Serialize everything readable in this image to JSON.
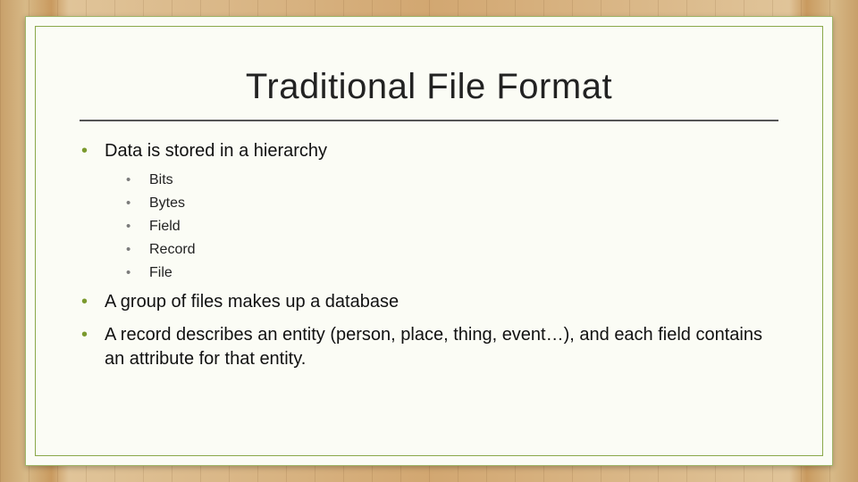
{
  "title": "Traditional File Format",
  "bullets": {
    "b1": "Data is stored in a hierarchy",
    "sub": {
      "s1": "Bits",
      "s2": "Bytes",
      "s3": "Field",
      "s4": "Record",
      "s5": "File"
    },
    "b2": "A group of files makes up a database",
    "b3": "A record describes an entity (person, place, thing, event…), and each field contains an attribute for that entity."
  }
}
